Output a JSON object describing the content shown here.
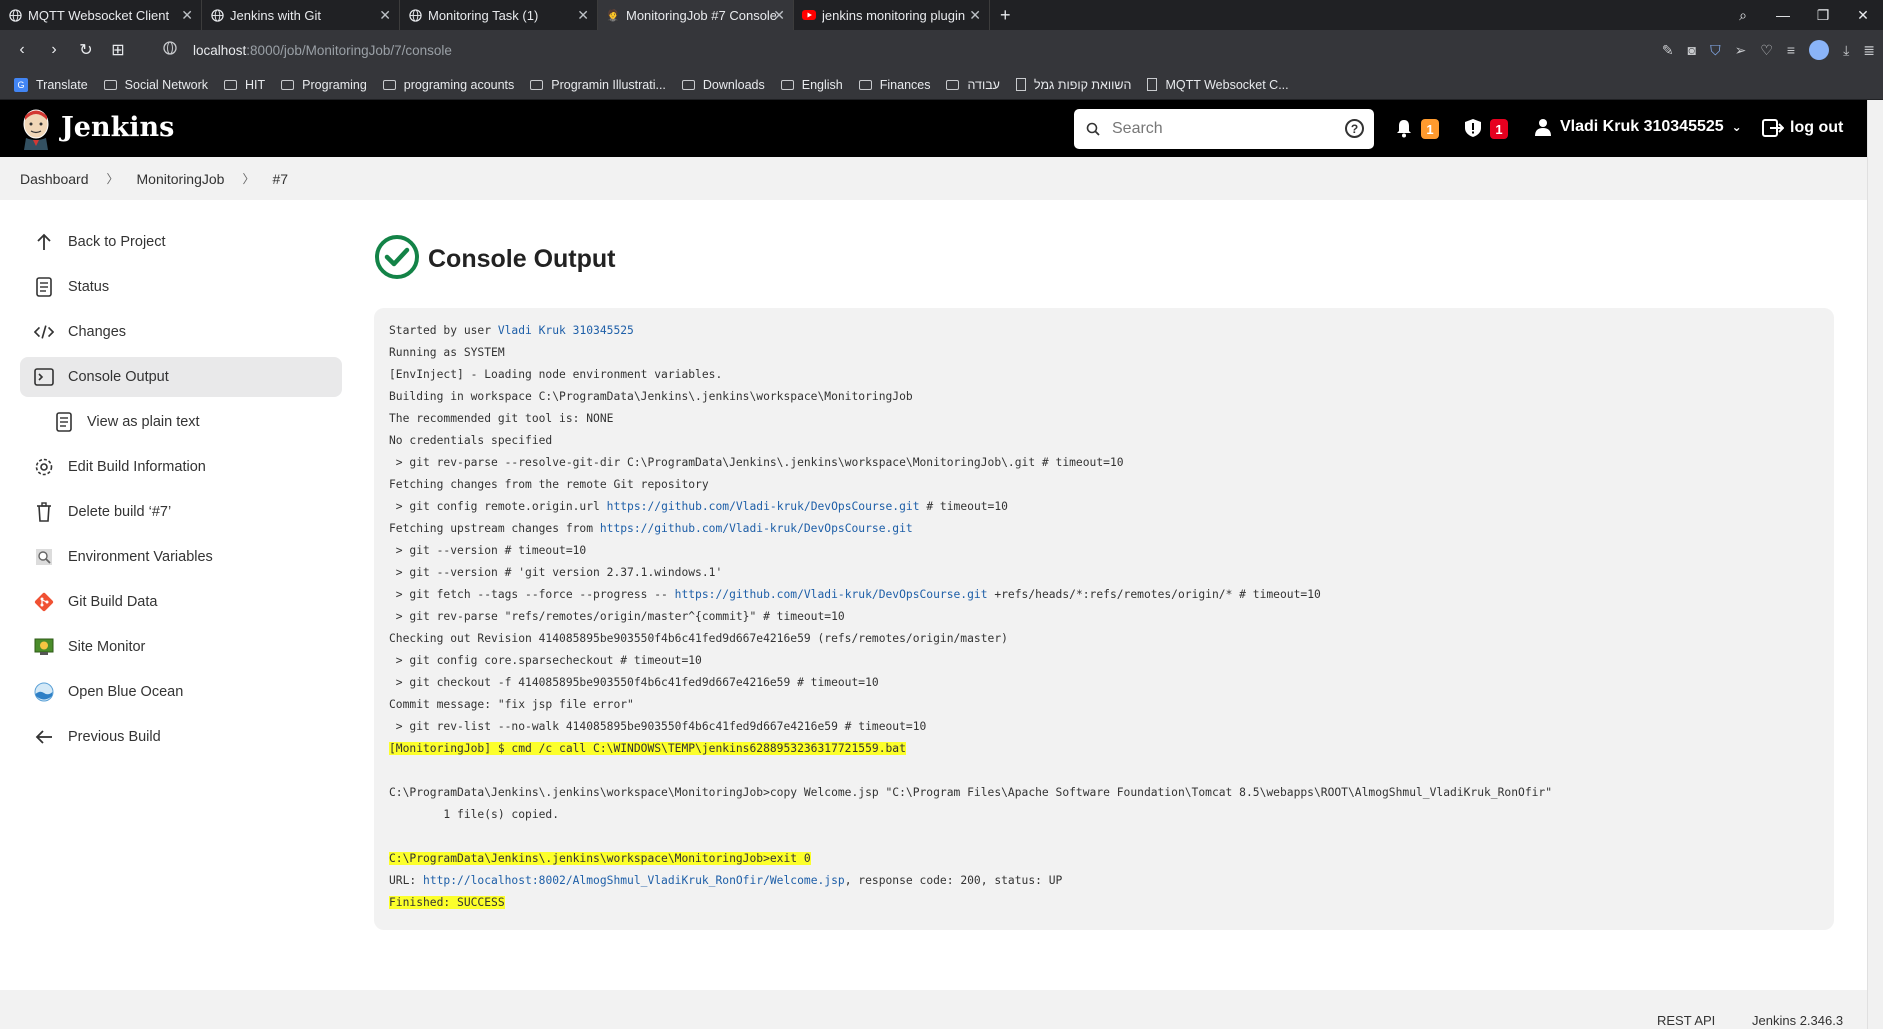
{
  "browser": {
    "tabs": [
      {
        "label": "MQTT Websocket Client",
        "active": false
      },
      {
        "label": "Jenkins with Git",
        "active": false
      },
      {
        "label": "Monitoring Task (1)",
        "active": false
      },
      {
        "label": "MonitoringJob #7 Console",
        "active": true
      },
      {
        "label": "jenkins monitoring plugin",
        "active": false
      }
    ],
    "url_host": "localhost",
    "url_path": ":8000/job/MonitoringJob/7/console",
    "bookmarks": [
      {
        "label": "Translate",
        "type": "translate"
      },
      {
        "label": "Social Network",
        "type": "folder"
      },
      {
        "label": "HIT",
        "type": "folder"
      },
      {
        "label": "Programing",
        "type": "folder"
      },
      {
        "label": "programing acounts",
        "type": "folder"
      },
      {
        "label": "Programin Illustrati...",
        "type": "folder"
      },
      {
        "label": "Downloads",
        "type": "folder"
      },
      {
        "label": "English",
        "type": "folder"
      },
      {
        "label": "Finances",
        "type": "folder"
      },
      {
        "label": "עבודה",
        "type": "folder"
      },
      {
        "label": "השוואת קופות גמל",
        "type": "doc"
      },
      {
        "label": "MQTT Websocket C...",
        "type": "doc"
      }
    ]
  },
  "header": {
    "title": "Jenkins",
    "search_placeholder": "Search",
    "notifications_count": "1",
    "security_count": "1",
    "user_name": "Vladi Kruk 310345525",
    "logout_label": "log out"
  },
  "breadcrumb": [
    "Dashboard",
    "MonitoringJob",
    "#7"
  ],
  "sidebar": {
    "items": [
      {
        "label": "Back to Project",
        "icon": "arrow-up-icon"
      },
      {
        "label": "Status",
        "icon": "document-icon"
      },
      {
        "label": "Changes",
        "icon": "code-icon"
      },
      {
        "label": "Console Output",
        "icon": "terminal-icon",
        "active": true
      },
      {
        "label": "View as plain text",
        "icon": "document-icon",
        "sub": true
      },
      {
        "label": "Edit Build Information",
        "icon": "gear-icon"
      },
      {
        "label": "Delete build ‘#7’",
        "icon": "trash-icon"
      },
      {
        "label": "Environment Variables",
        "icon": "magnifier-icon"
      },
      {
        "label": "Git Build Data",
        "icon": "git-icon"
      },
      {
        "label": "Site Monitor",
        "icon": "site-monitor-icon",
        "highlighted": true
      },
      {
        "label": "Open Blue Ocean",
        "icon": "blue-ocean-icon"
      },
      {
        "label": "Previous Build",
        "icon": "arrow-left-icon"
      }
    ]
  },
  "main": {
    "title": "Console Output",
    "status_color": "#138347",
    "lines": [
      {
        "parts": [
          {
            "t": "Started by user "
          },
          {
            "t": "Vladi Kruk 310345525",
            "link": true
          }
        ]
      },
      {
        "parts": [
          {
            "t": "Running as SYSTEM"
          }
        ]
      },
      {
        "parts": [
          {
            "t": "[EnvInject] - Loading node environment variables."
          }
        ]
      },
      {
        "parts": [
          {
            "t": "Building in workspace C:\\ProgramData\\Jenkins\\.jenkins\\workspace\\MonitoringJob"
          }
        ]
      },
      {
        "parts": [
          {
            "t": "The recommended git tool is: NONE"
          }
        ]
      },
      {
        "parts": [
          {
            "t": "No credentials specified"
          }
        ]
      },
      {
        "parts": [
          {
            "t": " > git rev-parse --resolve-git-dir C:\\ProgramData\\Jenkins\\.jenkins\\workspace\\MonitoringJob\\.git # timeout=10"
          }
        ]
      },
      {
        "parts": [
          {
            "t": "Fetching changes from the remote Git repository"
          }
        ]
      },
      {
        "parts": [
          {
            "t": " > git config remote.origin.url "
          },
          {
            "t": "https://github.com/Vladi-kruk/DevOpsCourse.git",
            "link": true
          },
          {
            "t": " # timeout=10"
          }
        ]
      },
      {
        "parts": [
          {
            "t": "Fetching upstream changes from "
          },
          {
            "t": "https://github.com/Vladi-kruk/DevOpsCourse.git",
            "link": true
          }
        ]
      },
      {
        "parts": [
          {
            "t": " > git --version # timeout=10"
          }
        ]
      },
      {
        "parts": [
          {
            "t": " > git --version # 'git version 2.37.1.windows.1'"
          }
        ]
      },
      {
        "parts": [
          {
            "t": " > git fetch --tags --force --progress -- "
          },
          {
            "t": "https://github.com/Vladi-kruk/DevOpsCourse.git",
            "link": true
          },
          {
            "t": " +refs/heads/*:refs/remotes/origin/* # timeout=10"
          }
        ]
      },
      {
        "parts": [
          {
            "t": " > git rev-parse \"refs/remotes/origin/master^{commit}\" # timeout=10"
          }
        ]
      },
      {
        "parts": [
          {
            "t": "Checking out Revision 414085895be903550f4b6c41fed9d667e4216e59 (refs/remotes/origin/master)"
          }
        ]
      },
      {
        "parts": [
          {
            "t": " > git config core.sparsecheckout # timeout=10"
          }
        ]
      },
      {
        "parts": [
          {
            "t": " > git checkout -f 414085895be903550f4b6c41fed9d667e4216e59 # timeout=10"
          }
        ]
      },
      {
        "parts": [
          {
            "t": "Commit message: \"fix jsp file error\""
          }
        ]
      },
      {
        "parts": [
          {
            "t": " > git rev-list --no-walk 414085895be903550f4b6c41fed9d667e4216e59 # timeout=10"
          }
        ]
      },
      {
        "parts": [
          {
            "t": "[MonitoringJob] $ cmd /c call C:\\WINDOWS\\TEMP\\jenkins6288953236317721559.bat",
            "hl": true
          }
        ]
      },
      {
        "parts": [
          {
            "t": ""
          }
        ]
      },
      {
        "parts": [
          {
            "t": "C:\\ProgramData\\Jenkins\\.jenkins\\workspace\\MonitoringJob>copy Welcome.jsp \"C:\\Program Files\\Apache Software Foundation\\Tomcat 8.5\\webapps\\ROOT\\AlmogShmul_VladiKruk_RonOfir\""
          }
        ]
      },
      {
        "parts": [
          {
            "t": "        1 file(s) copied."
          }
        ]
      },
      {
        "parts": [
          {
            "t": ""
          }
        ]
      },
      {
        "parts": [
          {
            "t": "C:\\ProgramData\\Jenkins\\.jenkins\\workspace\\MonitoringJob>exit 0",
            "hl": true
          }
        ]
      },
      {
        "parts": [
          {
            "t": "URL: "
          },
          {
            "t": "http://localhost:8002/AlmogShmul_VladiKruk_RonOfir/Welcome.jsp",
            "link": true
          },
          {
            "t": ", response code: 200, status: UP"
          }
        ]
      },
      {
        "parts": [
          {
            "t": "Finished: SUCCESS",
            "hl": true
          }
        ]
      }
    ]
  },
  "footer": {
    "rest_api": "REST API",
    "version": "Jenkins 2.346.3"
  }
}
